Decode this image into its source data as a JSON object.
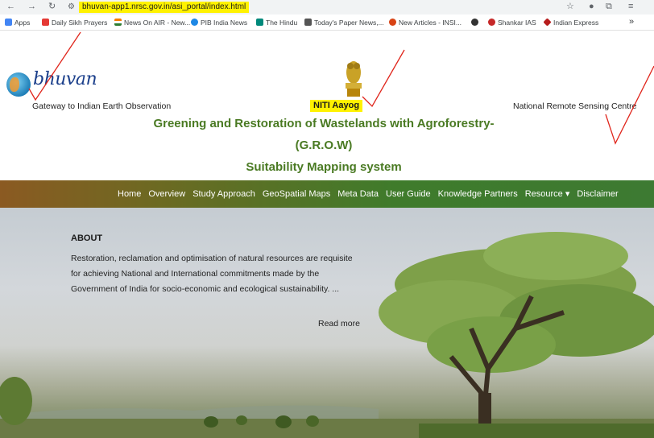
{
  "browser": {
    "url": "bhuvan-app1.nrsc.gov.in/asi_portal/index.html",
    "icons": [
      "back-icon",
      "forward-icon",
      "reload-icon",
      "site-settings-icon",
      "star-icon",
      "extension-icon",
      "puzzle-icon",
      "reading-list-icon"
    ],
    "bookmarks": [
      {
        "label": "Apps",
        "color": "#4285f4"
      },
      {
        "label": "Daily Sikh Prayers",
        "color": "#e53935"
      },
      {
        "label": "News On AIR - New...",
        "color": "#f57c00"
      },
      {
        "label": "PIB India News",
        "color": "#1e88e5"
      },
      {
        "label": "The Hindu",
        "color": "#00897b"
      },
      {
        "label": "Today's Paper News,...",
        "color": "#555555"
      },
      {
        "label": "New Articles - INSI...",
        "color": "#d84315"
      },
      {
        "label": "",
        "color": "#333333"
      },
      {
        "label": "Shankar IAS",
        "color": "#c62828"
      },
      {
        "label": "Indian Express",
        "color": "#b71c1c"
      }
    ],
    "more": "»"
  },
  "header": {
    "logo_text": "bhuvan",
    "gateway": "Gateway to Indian Earth Observation",
    "center_org": "NITI Aayog",
    "right_org": "National Remote Sensing Centre",
    "title_line1": "Greening and Restoration of Wastelands with Agroforestry-",
    "title_line2": "(G.R.O.W)",
    "title_line3": "Suitability Mapping system"
  },
  "menu": {
    "items": [
      "Home",
      "Overview",
      "Study Approach",
      "GeoSpatial Maps",
      "Meta Data",
      "User Guide",
      "Knowledge Partners",
      "Resource ▾",
      "Disclaimer"
    ]
  },
  "hero": {
    "about_title": "ABOUT",
    "about_text": "Restoration, reclamation and optimisation of natural resources are requisite for achieving National and International commitments made by the Government of India for socio-economic and ecological sustainability. ...",
    "read_more": "Read more"
  }
}
